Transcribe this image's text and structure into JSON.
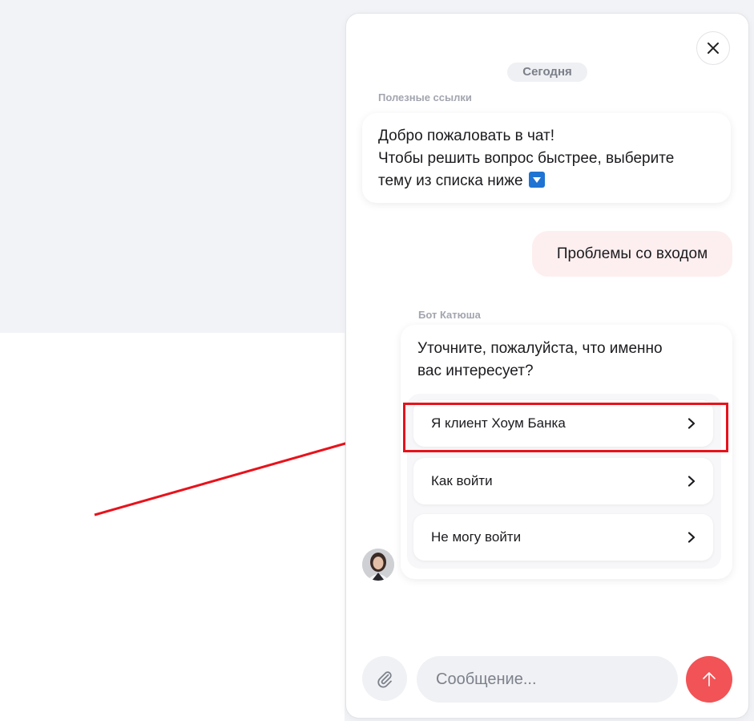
{
  "chat": {
    "date_label": "Сегодня",
    "welcome_sender": "Полезные ссылки",
    "welcome_lines": [
      "Добро пожаловать в чат!",
      "Чтобы решить вопрос быстрее, выберите",
      "тему из списка ниже"
    ],
    "welcome_emoji": "down-arrow-button-emoji",
    "user_message": "Проблемы со входом",
    "bot_sender": "Бот Катюша",
    "bot_question_lines": [
      "Уточните, пожалуйста, что именно",
      "вас интересует?"
    ],
    "options": [
      {
        "label": "Я клиент Хоум Банка",
        "highlighted": true
      },
      {
        "label": "Как войти",
        "highlighted": false
      },
      {
        "label": "Не могу войти",
        "highlighted": false
      }
    ],
    "input_placeholder": "Сообщение...",
    "icons": {
      "close": "close-icon",
      "chevron": "chevron-right-icon",
      "attach": "paperclip-icon",
      "send": "arrow-up-icon"
    }
  },
  "colors": {
    "accent_send": "#f25356",
    "user_bubble": "#fdeff0",
    "annotation": "#e8121b",
    "page_bg": "#f2f3f7"
  }
}
